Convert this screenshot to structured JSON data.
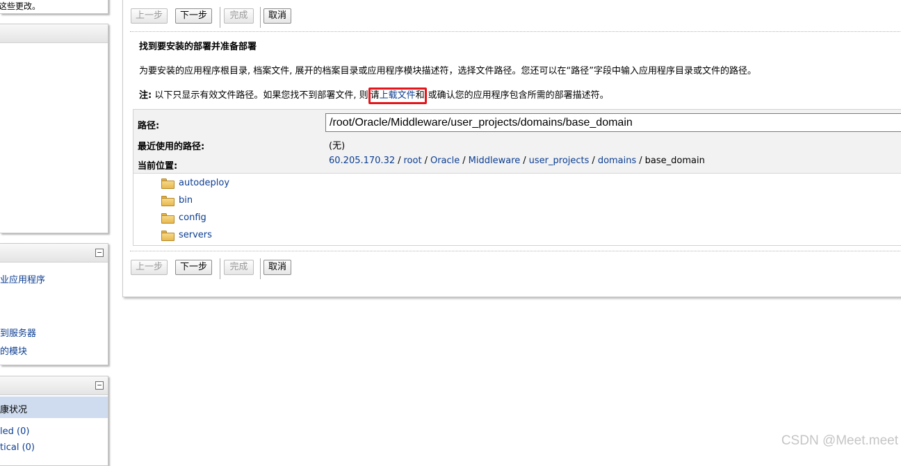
{
  "left_panels": {
    "top_text": "这些更改。",
    "deploy_tasks": {
      "links": [
        "业应用程序",
        "到服务器",
        "的模块"
      ]
    },
    "health": {
      "selected": "康状况",
      "links": [
        "led (0)",
        "tical (0)"
      ]
    },
    "collapse_symbol": "−"
  },
  "buttons": {
    "back": "上一步",
    "next": "下一步",
    "finish": "完成",
    "cancel": "取消"
  },
  "content": {
    "title": "找到要安装的部署并准备部署",
    "description": "为要安装的应用程序根目录, 档案文件, 展开的档案目录或应用程序模块描述符，选择文件路径。您还可以在“路径”字段中输入应用程序目录或文件的路径。",
    "note_label": "注:",
    "note_text_1": " 以下只显示有效文件路径。如果您找不到部署文件, 则",
    "note_highlight_1": "请",
    "note_link": "上载文件",
    "note_highlight_2": "和",
    "note_text_2": "或确认您的应用程序包含所需的部署描述符。"
  },
  "form": {
    "path_label": "路径:",
    "path_value": "/root/Oracle/Middleware/user_projects/domains/base_domain",
    "recent_label": "最近使用的路径:",
    "recent_value": "(无)",
    "location_label": "当前位置:",
    "breadcrumb": [
      "60.205.170.32",
      "root",
      "Oracle",
      "Middleware",
      "user_projects",
      "domains"
    ],
    "breadcrumb_current": "base_domain",
    "separator": "/"
  },
  "folders": [
    "autodeploy",
    "bin",
    "config",
    "servers"
  ],
  "watermark": "CSDN @Meet.meet"
}
